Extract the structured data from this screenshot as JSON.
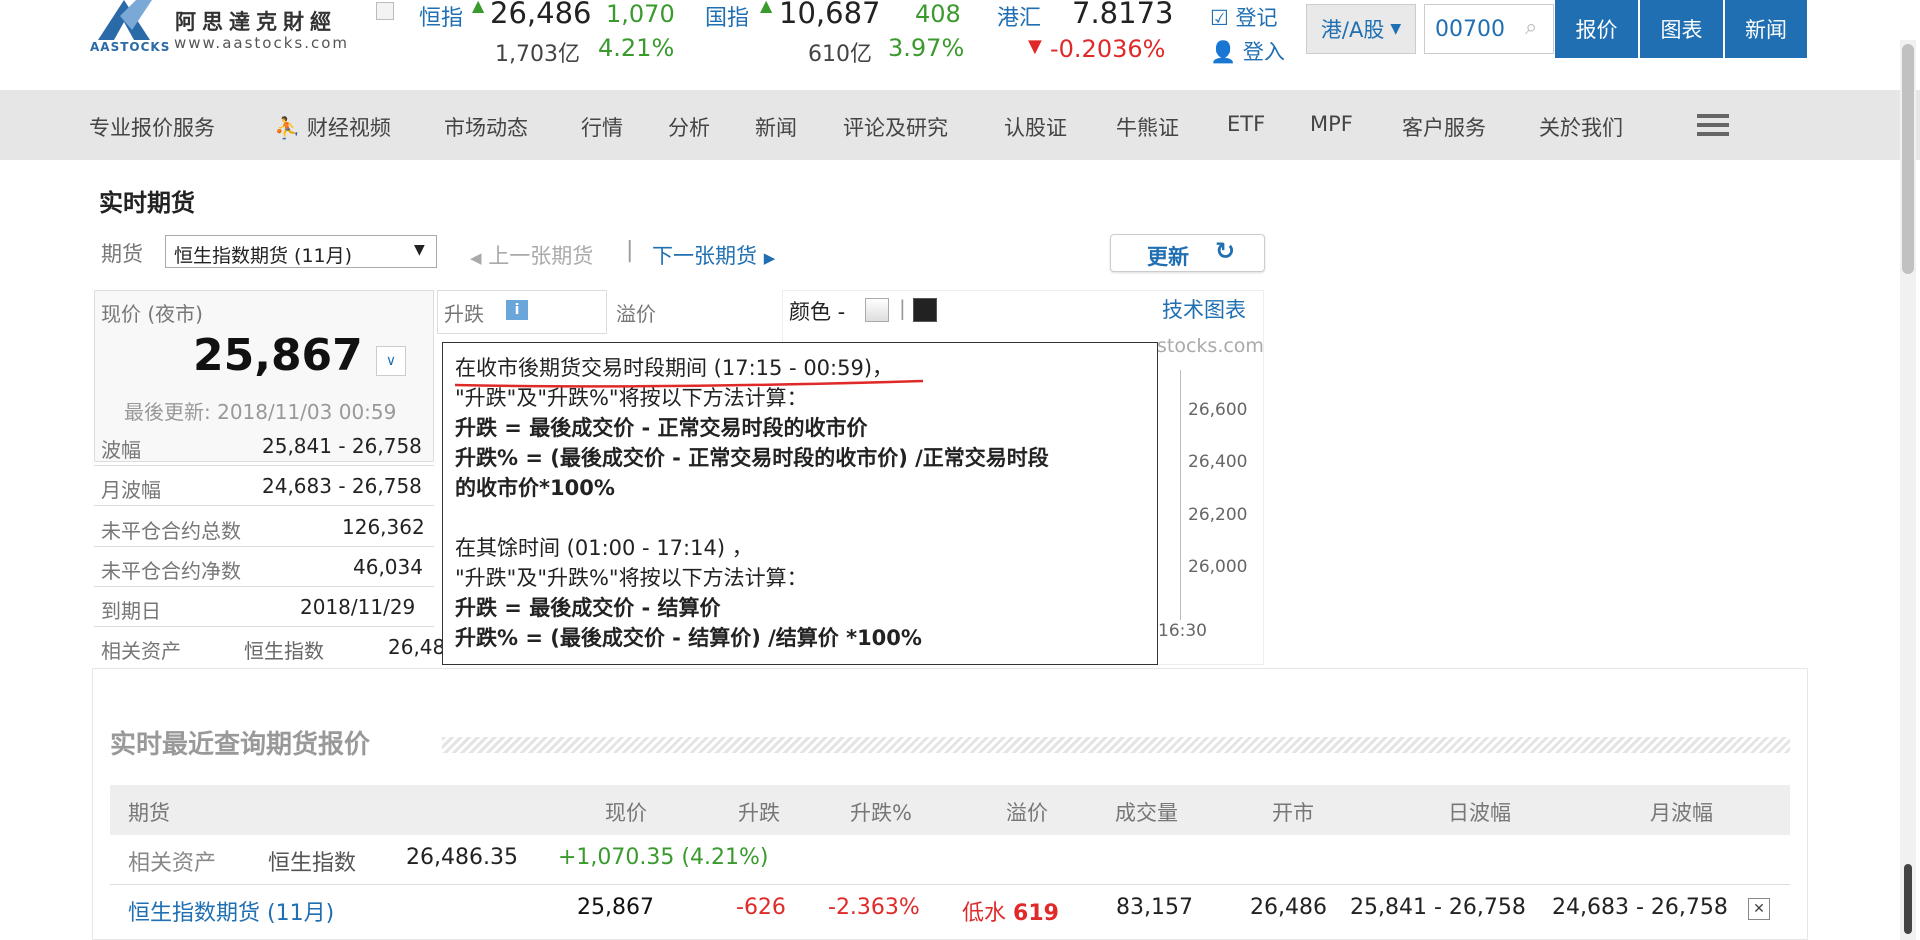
{
  "header": {
    "logo_cn": "阿思達克財經",
    "logo_url": "www.aastocks.com",
    "logo_brand": "AASTOCKS",
    "tickers": [
      {
        "name": "恒指",
        "value": "26,486",
        "change": "1,070",
        "turnover": "1,703亿",
        "pct": "4.21%"
      },
      {
        "name": "国指",
        "value": "10,687",
        "change": "408",
        "turnover": "610亿",
        "pct": "3.97%"
      }
    ],
    "fx": {
      "name": "港汇",
      "value": "7.8173",
      "change": "-0.2036%"
    },
    "register": "登记",
    "login": "登入",
    "market_select": "港/A股",
    "search_value": "00700",
    "buttons": [
      "报价",
      "图表",
      "新闻"
    ]
  },
  "nav": {
    "items": [
      "专业报价服务",
      "财经视频",
      "市场动态",
      "行情",
      "分析",
      "新闻",
      "评论及研究",
      "认股证",
      "牛熊证",
      "ETF",
      "MPF",
      "客户服务",
      "关於我们"
    ]
  },
  "page": {
    "title": "实时期货",
    "futures_label": "期货",
    "futures_select": "恒生指数期货 (11月)",
    "prev_label": "上一张期货",
    "next_label": "下一张期货",
    "refresh_label": "更新",
    "price_label": "现价 (夜市)",
    "price_value": "25,867",
    "last_update": "最後更新: 2018/11/03 00:59",
    "change_label": "升跌",
    "premium_label": "溢价",
    "color_label": "颜色 -",
    "tech_chart": "技术图表",
    "chart_site": "stocks.com",
    "chart_ticks": [
      "26,600",
      "26,400",
      "26,200",
      "26,000"
    ],
    "chart_time": "16:30",
    "stats": [
      {
        "label": "波幅",
        "value": "25,841 - 26,758"
      },
      {
        "label": "月波幅",
        "value": "24,683 - 26,758"
      },
      {
        "label": "未平仓合约总数",
        "value": "126,362"
      },
      {
        "label": "未平仓合约净数",
        "value": "46,034"
      },
      {
        "label": "到期日",
        "value": "2018/11/29"
      }
    ],
    "related_label": "相关资产",
    "related_name": "恒生指数",
    "related_value": "26,48"
  },
  "popup": {
    "line1": "在收市後期货交易时段期间 (17:15 - 00:59)，",
    "line2": "\"升跌\"及\"升跌%\"将按以下方法计算：",
    "line3": "升跌 = 最後成交价 - 正常交易时段的收市价",
    "line4": "升跌% = (最後成交价 - 正常交易时段的收市价) /正常交易时段",
    "line5": "的收市价*100%",
    "line6": "在其馀时间 (01:00 - 17:14) ，",
    "line7": "\"升跌\"及\"升跌%\"将按以下方法计算：",
    "line8": "升跌 = 最後成交价 - 结算价",
    "line9": "升跌% = (最後成交价 - 结算价) /结算价 *100%"
  },
  "recent": {
    "title": "实时最近查询期货报价",
    "headers": [
      "期货",
      "现价",
      "升跌",
      "升跌%",
      "溢价",
      "成交量",
      "开市",
      "日波幅",
      "月波幅"
    ],
    "asset_label": "相关资产",
    "asset_name": "恒生指数",
    "asset_value": "26,486.35",
    "asset_change": "+1,070.35 (4.21%)",
    "row": {
      "name": "恒生指数期货 (11月)",
      "price": "25,867",
      "change": "-626",
      "pct": "-2.363%",
      "premium_word": "低水",
      "premium": "619",
      "volume": "83,157",
      "open": "26,486",
      "day_range": "25,841 - 26,758",
      "month_range": "24,683 - 26,758"
    }
  },
  "colors": {
    "accent": "#1f6fb2",
    "up": "#3a9a2e",
    "down": "#e02a2a",
    "nav_bg": "#e6e6e6"
  }
}
